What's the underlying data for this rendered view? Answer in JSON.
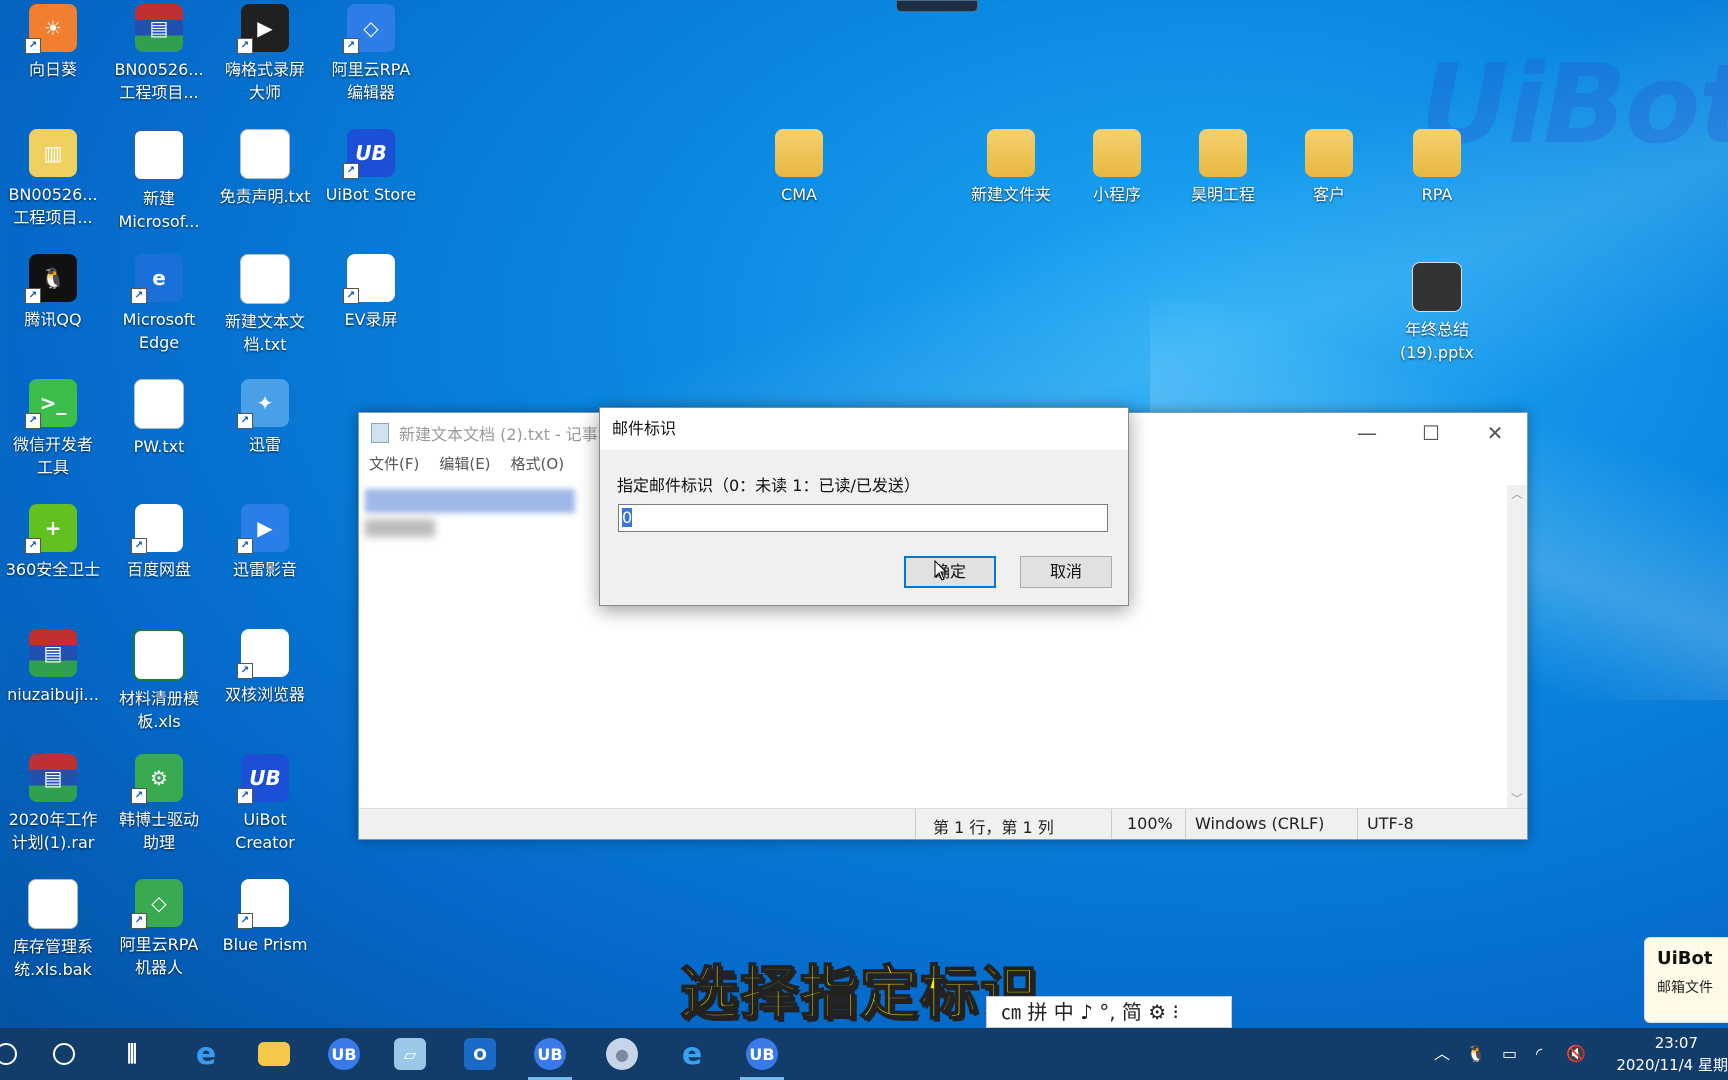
{
  "desktop": {
    "watermark": "UiBot",
    "icons": [
      {
        "label": "向日葵"
      },
      {
        "label": "BN00526...\n工程项目..."
      },
      {
        "label": "嗨格式录屏\n大师"
      },
      {
        "label": "阿里云RPA\n编辑器"
      },
      {
        "label": "BN00526...\n工程项目..."
      },
      {
        "label": "新建\nMicrosof..."
      },
      {
        "label": "免责声明.txt"
      },
      {
        "label": "UiBot Store"
      },
      {
        "label": "腾讯QQ"
      },
      {
        "label": "Microsoft\nEdge"
      },
      {
        "label": "新建文本文\n档.txt"
      },
      {
        "label": "EV录屏"
      },
      {
        "label": "微信开发者\n工具"
      },
      {
        "label": "PW.txt"
      },
      {
        "label": "迅雷"
      },
      {
        "label": "360安全卫士"
      },
      {
        "label": "百度网盘"
      },
      {
        "label": "迅雷影音"
      },
      {
        "label": "niuzaibuji..."
      },
      {
        "label": "材料清册模\n板.xls"
      },
      {
        "label": "双核浏览器"
      },
      {
        "label": "2020年工作\n计划(1).rar"
      },
      {
        "label": "韩博士驱动\n助理"
      },
      {
        "label": "UiBot\nCreator"
      },
      {
        "label": "库存管理系\n统.xls.bak"
      },
      {
        "label": "阿里云RPA\n机器人"
      },
      {
        "label": "Blue Prism"
      },
      {
        "label": "CMA"
      },
      {
        "label": "新建文件夹"
      },
      {
        "label": "小程序"
      },
      {
        "label": "昊明工程"
      },
      {
        "label": "客户"
      },
      {
        "label": "RPA"
      },
      {
        "label": "年终总结\n(19).pptx"
      }
    ]
  },
  "notepad": {
    "title": "新建文本文档 (2).txt - 记事本",
    "menu": [
      "文件(F)",
      "编辑(E)",
      "格式(O)"
    ],
    "status": {
      "position": "第 1 行，第 1 列",
      "zoom": "100%",
      "line_ending": "Windows (CRLF)",
      "encoding": "UTF-8"
    }
  },
  "dialog": {
    "title": "邮件标识",
    "prompt": "指定邮件标识（0：未读 1：已读/已发送）",
    "input_value": "0",
    "ok_label": "确定",
    "cancel_label": "取消"
  },
  "subtitle": "选择指定标识",
  "ime": "㎝ 拼 中 ♪ °, 简 ⚙ ⁝",
  "notification": {
    "title": "UiBot",
    "body": "邮箱文件"
  },
  "taskbar": {
    "clock_time": "23:07",
    "clock_date": "2020/11/4 星期"
  }
}
